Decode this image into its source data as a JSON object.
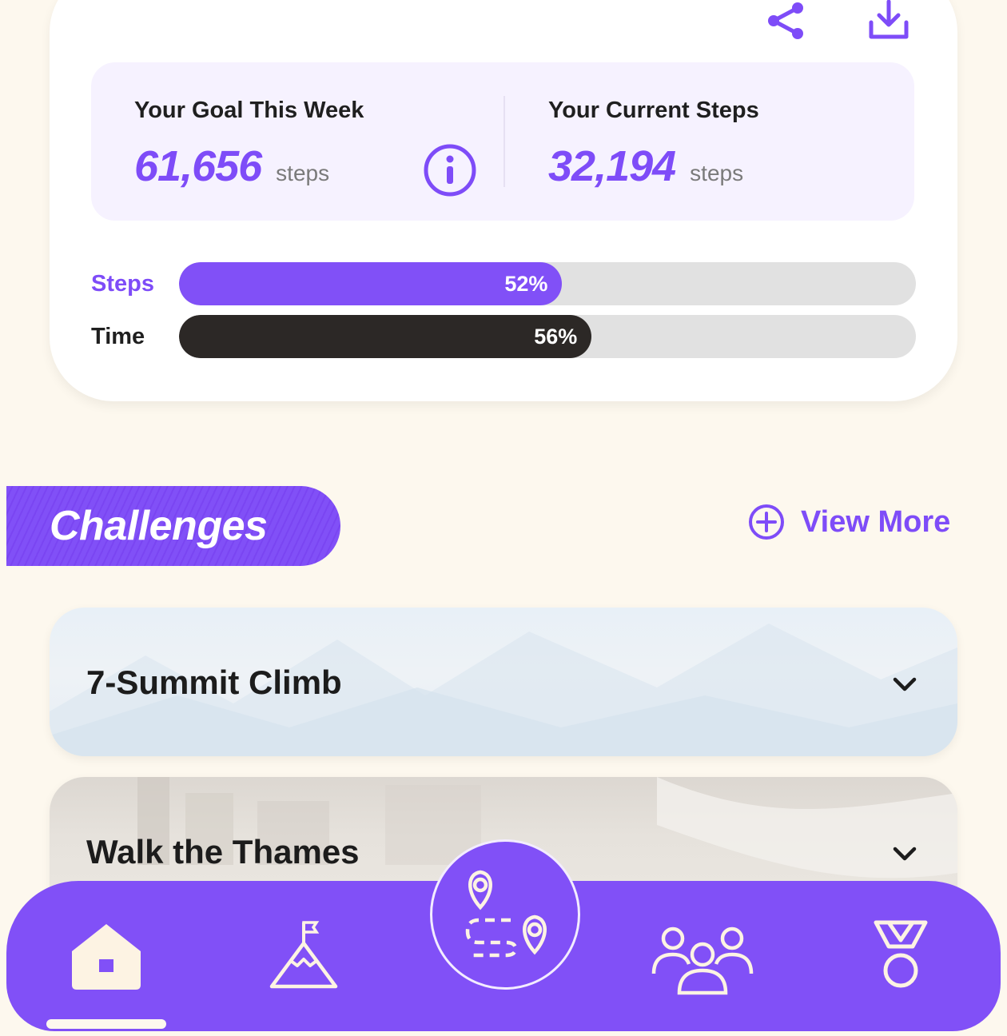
{
  "colors": {
    "accent": "#7e4cf8",
    "nav_background": "#8150f7",
    "page_background": "#fdf8ee",
    "time_bar": "#2c2826",
    "track": "#e1e1e1"
  },
  "goal_card": {
    "actions": [
      {
        "icon": "share-icon"
      },
      {
        "icon": "download-icon"
      }
    ],
    "goal": {
      "title": "Your Goal This Week",
      "value": "61,656",
      "unit": "steps"
    },
    "info_icon": "info-icon",
    "current": {
      "title": "Your Current Steps",
      "value": "32,194",
      "unit": "steps"
    },
    "progress": [
      {
        "label": "Steps",
        "percent_text": "52%",
        "fraction": 0.52,
        "color": "#8150f7",
        "label_color": "#7e4cf8"
      },
      {
        "label": "Time",
        "percent_text": "56%",
        "fraction": 0.56,
        "color": "#2c2826",
        "label_color": "#1f1f1f"
      }
    ]
  },
  "challenges": {
    "heading": "Challenges",
    "view_more": "View More",
    "items": [
      {
        "title": "7-Summit Climb"
      },
      {
        "title": "Walk the Thames"
      }
    ]
  },
  "bottom_nav": {
    "items": [
      {
        "icon": "home-icon",
        "active": true
      },
      {
        "icon": "mountain-flag-icon",
        "active": false
      },
      {
        "icon": "route-map-icon",
        "active": false
      },
      {
        "icon": "community-icon",
        "active": false
      },
      {
        "icon": "medal-icon",
        "active": false
      }
    ]
  }
}
